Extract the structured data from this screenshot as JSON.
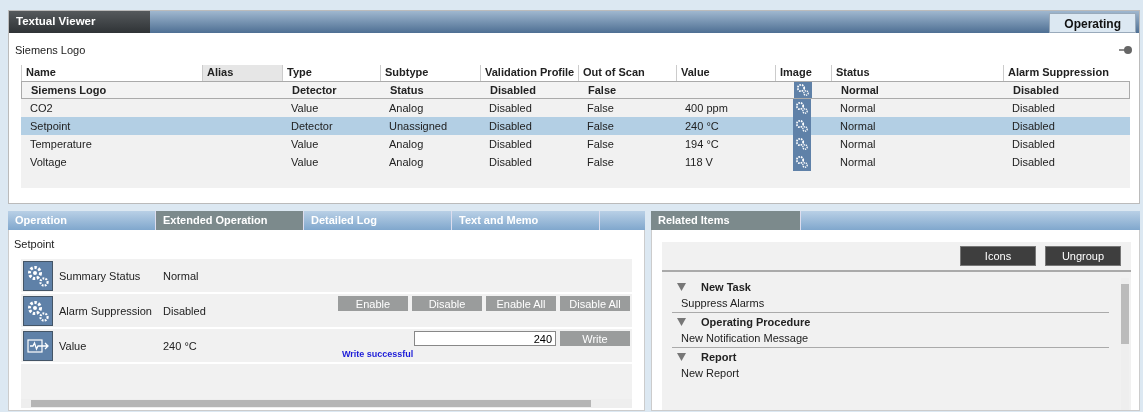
{
  "viewer": {
    "title": "Textual Viewer",
    "mode": "Operating",
    "breadcrumb": "Siemens Logo"
  },
  "table": {
    "columns": [
      {
        "label": "Name",
        "shaded": false
      },
      {
        "label": "Alias",
        "shaded": true
      },
      {
        "label": "Type",
        "shaded": false
      },
      {
        "label": "Subtype",
        "shaded": false
      },
      {
        "label": "Validation Profile",
        "shaded": false
      },
      {
        "label": "Out of Scan",
        "shaded": false
      },
      {
        "label": "Value",
        "shaded": false
      },
      {
        "label": "Image",
        "shaded": false
      },
      {
        "label": "Status",
        "shaded": false
      },
      {
        "label": "Alarm Suppression",
        "shaded": false
      }
    ],
    "rows": [
      {
        "kind": "summary",
        "selected": false,
        "name": "Siemens Logo",
        "type": "Detector",
        "subtype": "Status",
        "validation": "Disabled",
        "out_of_scan": "False",
        "status": "Normal",
        "alarm_suppression": "Disabled"
      },
      {
        "kind": "point",
        "selected": false,
        "name": "CO2",
        "type": "Value",
        "subtype": "Analog",
        "validation": "Disabled",
        "out_of_scan": "False",
        "value": "400 ppm",
        "status": "Normal",
        "alarm_suppression": "Disabled"
      },
      {
        "kind": "point",
        "selected": true,
        "name": "Setpoint",
        "type": "Detector",
        "subtype": "Unassigned",
        "validation": "Disabled",
        "out_of_scan": "False",
        "value": "240 °C",
        "status": "Normal",
        "alarm_suppression": "Disabled"
      },
      {
        "kind": "point",
        "selected": false,
        "name": "Temperature",
        "type": "Value",
        "subtype": "Analog",
        "validation": "Disabled",
        "out_of_scan": "False",
        "value": "194 °C",
        "status": "Normal",
        "alarm_suppression": "Disabled"
      },
      {
        "kind": "point",
        "selected": false,
        "name": "Voltage",
        "type": "Value",
        "subtype": "Analog",
        "validation": "Disabled",
        "out_of_scan": "False",
        "value": "118 V",
        "status": "Normal",
        "alarm_suppression": "Disabled"
      }
    ]
  },
  "operation": {
    "tabs": [
      {
        "label": "Operation",
        "selected": false
      },
      {
        "label": "Extended Operation",
        "selected": true
      },
      {
        "label": "Detailed Log",
        "selected": false
      },
      {
        "label": "Text and Memo",
        "selected": false
      }
    ],
    "heading": "Setpoint",
    "properties": [
      {
        "kind": "status",
        "label": "Summary Status",
        "value": "Normal"
      },
      {
        "kind": "commands",
        "label": "Alarm Suppression",
        "value": "Disabled",
        "buttons": [
          "Enable",
          "Disable",
          "Enable All",
          "Disable All"
        ]
      },
      {
        "kind": "write",
        "label": "Value",
        "value": "240 °C",
        "input": "240",
        "button": "Write",
        "message": "Write successful"
      }
    ]
  },
  "related": {
    "title": "Related Items",
    "buttons": [
      "Icons",
      "Ungroup"
    ],
    "groups": [
      {
        "label": "New Task",
        "expanded": true,
        "items": [
          "Suppress Alarms"
        ]
      },
      {
        "label": "Operating Procedure",
        "expanded": true,
        "items": [
          "New Notification Message"
        ]
      },
      {
        "label": "Report",
        "expanded": true,
        "items": [
          "New Report"
        ]
      }
    ]
  }
}
